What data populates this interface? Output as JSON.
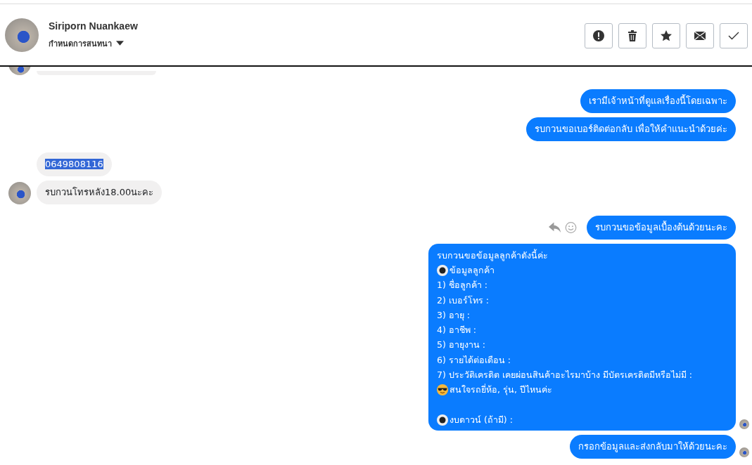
{
  "header": {
    "name": "Siriporn Nuankaew",
    "subtitle": "กำหนดการสนทนา",
    "actions": [
      {
        "kind": "report"
      },
      {
        "kind": "delete"
      },
      {
        "kind": "star"
      },
      {
        "kind": "mail"
      },
      {
        "kind": "done"
      }
    ]
  },
  "messages": [
    {
      "kind": "incoming_cut",
      "avatar": true
    },
    {
      "kind": "outgoing",
      "text": "เรามีเจ้าหน้าที่ดูแลเรื่องนี้โดยเฉพาะ"
    },
    {
      "kind": "outgoing",
      "text": "รบกวนขอเบอร์ติดต่อกลับ เพื่อให้คำแนะนำด้วยค่ะ"
    },
    {
      "kind": "incoming",
      "text": "0649808116",
      "highlighted": true
    },
    {
      "kind": "incoming",
      "text": "รบกวนโทรหลัง18.00นะคะ",
      "avatar": true
    },
    {
      "kind": "outgoing",
      "text": "รบกวนขอข้อมูลเบื้องต้นด้วยนะคะ",
      "show_actions": true
    },
    {
      "kind": "outgoing_list",
      "seen": true,
      "lines": [
        {
          "kind": "plain",
          "text": "รบกวนขอข้อมูลลูกค้าดังนี้ค่ะ"
        },
        {
          "kind": "radio",
          "text": "ข้อมูลลูกค้า"
        },
        {
          "kind": "plain",
          "text": "1) ชื่อลูกค้า :"
        },
        {
          "kind": "plain",
          "text": "2) เบอร์โทร :"
        },
        {
          "kind": "plain",
          "text": "3) อายุ :"
        },
        {
          "kind": "plain",
          "text": "4) อาชีพ :"
        },
        {
          "kind": "plain",
          "text": "5) อายุงาน :"
        },
        {
          "kind": "plain",
          "text": "6) รายได้ต่อเดือน :"
        },
        {
          "kind": "plain",
          "text": "7) ประวัติเครดิต  เคยผ่อนสินค้าอะไรมาบ้าง มีบัตรเครดิตมีหรือไม่มี :"
        },
        {
          "kind": "emoji",
          "text": "สนใจรถยี่ห้อ, รุ่น, ปีไหนค่ะ"
        },
        {
          "kind": "blank"
        },
        {
          "kind": "radio",
          "text": "งบดาวน์ (ถ้ามี) :"
        }
      ]
    },
    {
      "kind": "outgoing",
      "text": "กรอกข้อมูลและส่งกลับมาให้ด้วยนะคะ",
      "seen": true
    }
  ]
}
